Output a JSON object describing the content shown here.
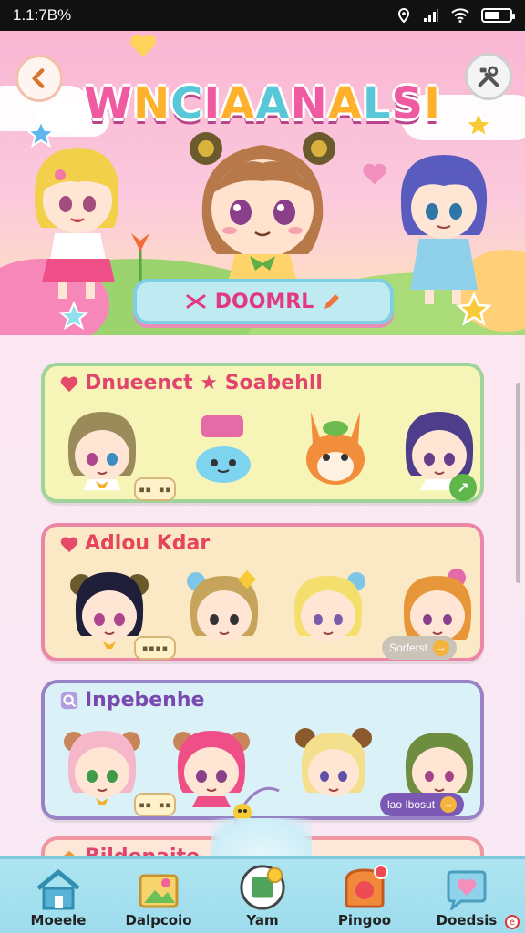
{
  "status_bar": {
    "time": "1.1:7B%"
  },
  "hero": {
    "title": "WNCIAANALSI",
    "search_label": "DOOMRL",
    "back_icon": "chevron-left-icon",
    "settings_icon": "tools-icon"
  },
  "cards": [
    {
      "title": "Dnueenct ★ Soabehll",
      "tag": "▪▪ ▪▪",
      "color": "#f6f5b7",
      "border": "#9ed39a",
      "title_color": "#e0456f",
      "action": "↗"
    },
    {
      "title": "Adlou Kdar",
      "tag": "▪▪▪▪",
      "color": "#fbe9c6",
      "border": "#ec86a6",
      "title_color": "#e5455b",
      "pill": "Sorferst"
    },
    {
      "title": "Inpebenhe",
      "tag": "▪▪ ▪▪",
      "color": "#dbf1f8",
      "border": "#9882c6",
      "title_color": "#7a49b0",
      "pill": "lao Ibosut"
    },
    {
      "title": "Bildenaite",
      "color": "#fde7d8",
      "border": "#ee97a2",
      "title_color": "#e0456f"
    }
  ],
  "bottom_nav": [
    {
      "label": "Moeele",
      "icon": "home-icon"
    },
    {
      "label": "Dalpcoio",
      "icon": "gallery-icon"
    },
    {
      "label": "Yam",
      "icon": "create-icon"
    },
    {
      "label": "Pingoo",
      "icon": "shop-icon"
    },
    {
      "label": "Doedsis",
      "icon": "heart-chat-icon"
    }
  ]
}
